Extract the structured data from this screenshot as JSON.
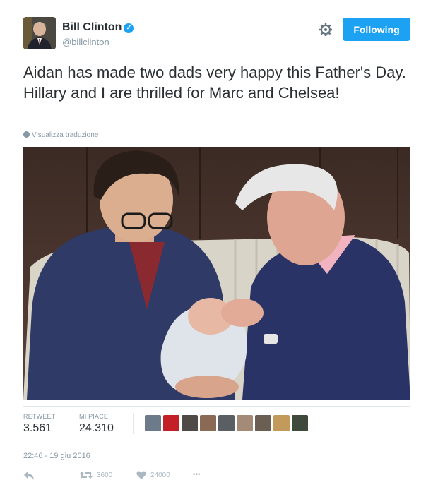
{
  "author": {
    "name": "Bill Clinton",
    "handle": "@billclinton",
    "verified_icon": "verified-badge-icon"
  },
  "follow_button": {
    "label": "Following"
  },
  "tweet": {
    "text": "Aidan has made two dads very happy this Father's Day. Hillary and I are thrilled for Marc and Chelsea!",
    "translate_label": "Visualizza traduzione"
  },
  "stats": {
    "retweet_label": "RETWEET",
    "retweet_count": "3.561",
    "like_label": "MI PIACE",
    "like_count": "24.310"
  },
  "timestamp": "22:46 - 19 giu 2016",
  "actions": {
    "retweet_count": "3600",
    "like_count": "24000",
    "more": "•••"
  },
  "colors": {
    "accent": "#1da1f2",
    "text": "#292f33",
    "muted": "#8899a6"
  }
}
